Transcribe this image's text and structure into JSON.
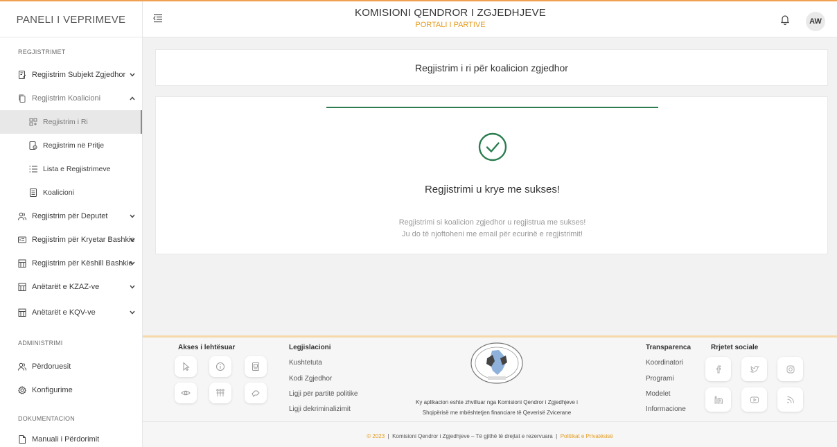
{
  "header": {
    "brand": "PANELI I VEPRIMEVE",
    "title": "KOMISIONI QENDROR I ZGJEDHJEVE",
    "subtitle": "PORTALI I PARTIVE",
    "avatar_initials": "AW"
  },
  "sidebar": {
    "sections": {
      "registrations": "REGJISTRIMET",
      "administration": "ADMINISTRIMI",
      "documentation": "DOKUMENTACION"
    },
    "items": [
      {
        "label": "Regjistrim Subjekt Zgjedhor",
        "icon": "document-edit-icon",
        "expanded": false
      },
      {
        "label": "Regjistrim Koalicioni",
        "icon": "copy-icon",
        "expanded": true
      },
      {
        "label": "Regjistrim i Ri",
        "icon": "grid-add-icon",
        "active": true
      },
      {
        "label": "Regjistrim në Pritje",
        "icon": "document-clock-icon"
      },
      {
        "label": "Lista e Regjistrimeve",
        "icon": "list-icon"
      },
      {
        "label": "Koalicioni",
        "icon": "document-list-icon"
      },
      {
        "label": "Regjistrim për Deputet",
        "icon": "users-icon",
        "expanded": false
      },
      {
        "label": "Regjistrim për Kryetar Bashkie",
        "icon": "id-card-icon",
        "expanded": false
      },
      {
        "label": "Regjistrim për Këshill Bashkie",
        "icon": "building-icon",
        "expanded": false
      },
      {
        "label": "Anëtarët e KZAZ-ve",
        "icon": "building-icon",
        "expanded": false
      },
      {
        "label": "Anëtarët e KQV-ve",
        "icon": "building-icon",
        "expanded": false
      },
      {
        "label": "Përdoruesit",
        "icon": "users-icon"
      },
      {
        "label": "Konfigurime",
        "icon": "gear-icon"
      },
      {
        "label": "Manuali i Përdorimit",
        "icon": "file-icon"
      }
    ]
  },
  "main": {
    "page_title": "Regjistrim i ri për koalicion zgjedhor",
    "success_title": "Regjistrimi u krye me sukses!",
    "success_line1": "Regjistrimi si koalicion zgjedhor u regjistrua me sukses!",
    "success_line2": "Ju do të njoftoheni me email për ecurinë e regjistrimit!"
  },
  "footer": {
    "accessibility_heading": "Akses i lehtësuar",
    "legislation_heading": "Legjislacioni",
    "legislation_links": [
      "Kushtetuta",
      "Kodi Zgjedhor",
      "Ligji për partitë politike",
      "Ligji dekriminalizimit"
    ],
    "transparency_heading": "Transparenca",
    "transparency_links": [
      "Koordinatori",
      "Programi",
      "Modelet",
      "Informacione"
    ],
    "social_heading": "Rrjetet sociale",
    "note_line1": "Ky aplikacion eshte zhvilluar nga Komisioni Qendror i Zgjedhjeve i",
    "note_line2": "Shqipërisë me mbështetjen financiare të Qeverisë Zvicerane",
    "copyright_year": "© 2023",
    "copyright_sep": "|",
    "copyright_text": "Komisioni Qendror i Zgjedhjeve – Të gjithë të drejtat e rezervuara",
    "privacy": "Politikat e Privatësisë"
  },
  "colors": {
    "accent_orange": "#e49a1a",
    "success_green": "#2a7d4f"
  }
}
